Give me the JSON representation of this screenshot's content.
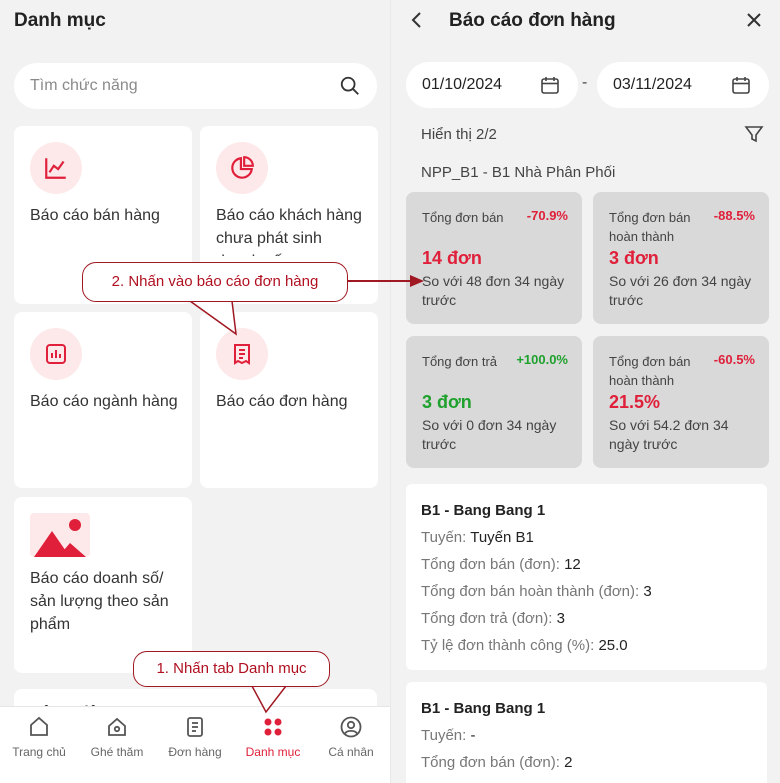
{
  "left": {
    "title": "Danh mục",
    "search_placeholder": "Tìm chức năng",
    "cards": [
      {
        "label": "Báo cáo bán hàng",
        "icon": "line-chart-icon"
      },
      {
        "label": "Báo cáo khách hàng chưa phát sinh doanh số",
        "icon": "pie-chart-icon"
      },
      {
        "label": "Báo cáo ngành hàng",
        "icon": "bar-chart-icon"
      },
      {
        "label": "Báo cáo đơn hàng",
        "icon": "receipt-icon"
      },
      {
        "label": "Báo cáo doanh số/ sản lượng theo sản phẩm",
        "icon": "image-icon"
      },
      {
        "label": "Công việc",
        "icon": ""
      }
    ],
    "nav": [
      {
        "label": "Trang chủ",
        "icon": "home-icon",
        "active": false
      },
      {
        "label": "Ghé thăm",
        "icon": "location-home-icon",
        "active": false
      },
      {
        "label": "Đơn hàng",
        "icon": "order-icon",
        "active": false
      },
      {
        "label": "Danh mục",
        "icon": "grid-icon",
        "active": true
      },
      {
        "label": "Cá nhân",
        "icon": "user-icon",
        "active": false
      }
    ]
  },
  "right": {
    "title": "Báo cáo đơn hàng",
    "date_from": "01/10/2024",
    "date_to": "03/11/2024",
    "date_separator": "-",
    "showing": "Hiển thị 2/2",
    "npp": "NPP_B1 - B1 Nhà Phân Phối",
    "stats": [
      {
        "name": "Tổng đơn bán",
        "pct": "-70.9%",
        "value": "14 đơn",
        "compare": "So với 48 đơn 34 ngày trước"
      },
      {
        "name": "Tổng đơn bán hoàn thành",
        "pct": "-88.5%",
        "value": "3 đơn",
        "compare": "So với 26 đơn 34 ngày trước"
      },
      {
        "name": "Tổng đơn trả",
        "pct": "+100.0%",
        "value": "3 đơn",
        "compare": "So với 0 đơn 34 ngày trước"
      },
      {
        "name": "Tổng đơn bán hoàn thành",
        "pct": "-60.5%",
        "value": "21.5%",
        "compare": "So với 54.2 đơn 34 ngày trước"
      }
    ],
    "details": [
      {
        "title": "B1 - Bang Bang 1",
        "rows": [
          {
            "label": "Tuyến:",
            "value": "Tuyến B1"
          },
          {
            "label": "Tổng đơn bán (đơn):",
            "value": "12"
          },
          {
            "label": "Tổng đơn bán hoàn thành (đơn):",
            "value": "3"
          },
          {
            "label": "Tổng đơn trả (đơn):",
            "value": "3"
          },
          {
            "label": "Tỷ lệ đơn thành công (%):",
            "value": "25.0"
          }
        ]
      },
      {
        "title": "B1 - Bang Bang 1",
        "rows": [
          {
            "label": "Tuyến:",
            "value": "-"
          },
          {
            "label": "Tổng đơn bán (đơn):",
            "value": "2"
          }
        ]
      }
    ]
  },
  "annotations": {
    "step1": "1. Nhấn tab Danh mục",
    "step2": "2. Nhấn vào báo cáo đơn hàng"
  },
  "colors": {
    "accent": "#e0203a",
    "positive": "#1fa12d",
    "callout_border": "#a01822"
  }
}
